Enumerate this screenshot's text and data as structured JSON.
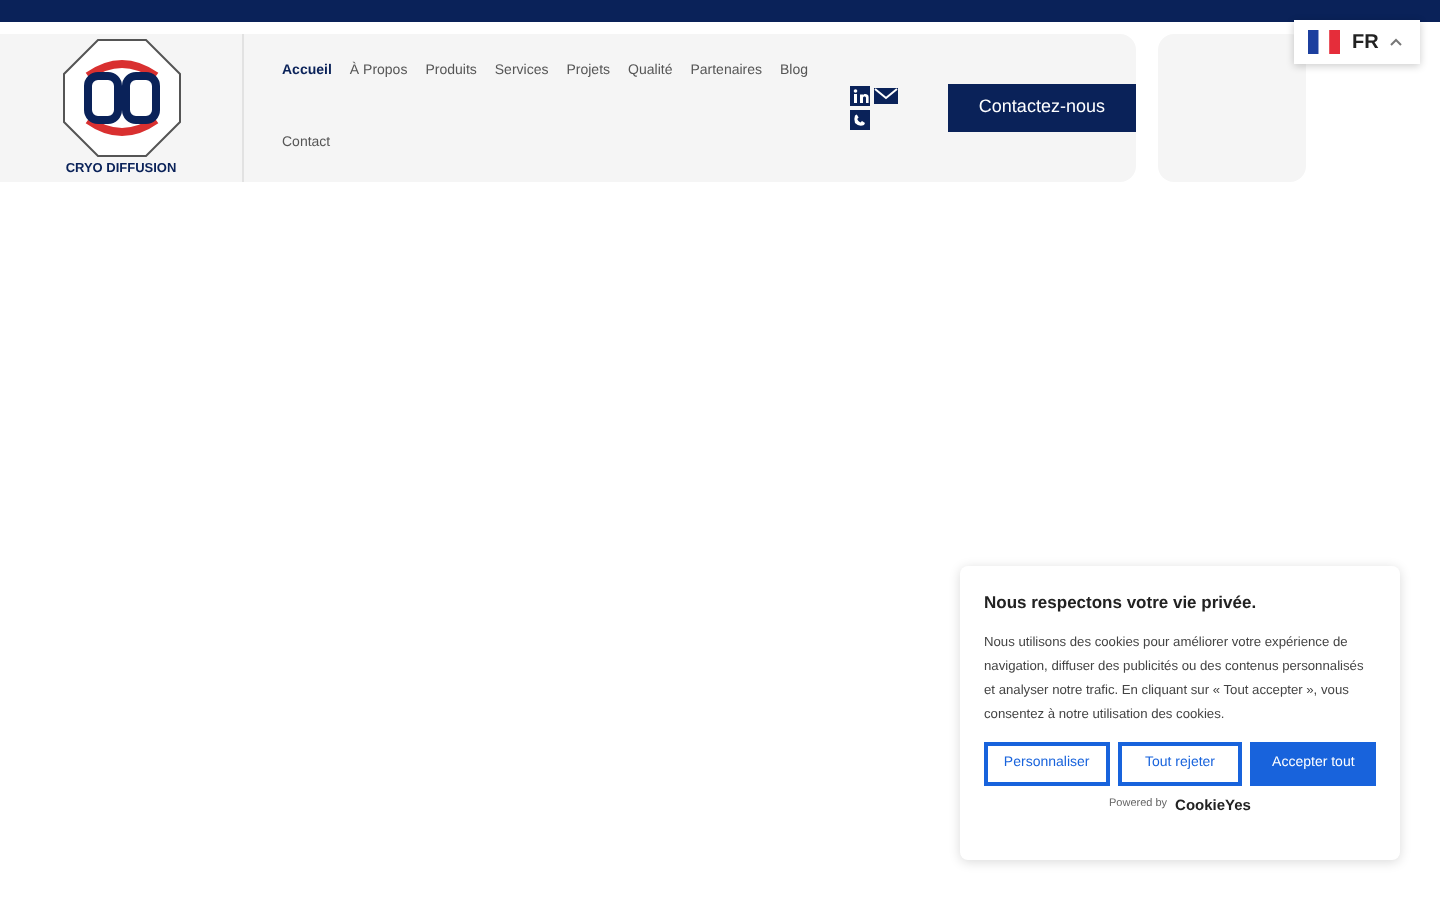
{
  "logo": {
    "text": "CRYO DIFFUSION"
  },
  "nav": [
    {
      "label": "Accueil",
      "selected": true
    },
    {
      "label": "À Propos",
      "selected": false
    },
    {
      "label": "Produits",
      "selected": false
    },
    {
      "label": "Services",
      "selected": false
    },
    {
      "label": "Projets",
      "selected": false
    },
    {
      "label": "Qualité",
      "selected": false
    },
    {
      "label": "Partenaires",
      "selected": false
    },
    {
      "label": "Blog",
      "selected": false
    },
    {
      "label": "Contact",
      "selected": false
    }
  ],
  "contact_button": "Contactez-nous",
  "language": {
    "code": "FR"
  },
  "cookie_banner": {
    "title": "Nous respectons votre vie privée.",
    "text": "Nous utilisons des cookies pour améliorer votre expérience de navigation, diffuser des publicités ou des contenus personnalisés et analyser notre trafic. En cliquant sur « Tout accepter », vous consentez à notre utilisation des cookies.",
    "buttons": [
      {
        "label": "Personnaliser",
        "kind": "outline"
      },
      {
        "label": "Tout rejeter",
        "kind": "outline"
      },
      {
        "label": "Accepter tout",
        "kind": "primary"
      }
    ],
    "powered_by": "Powered by",
    "brand": "CookieYes"
  }
}
